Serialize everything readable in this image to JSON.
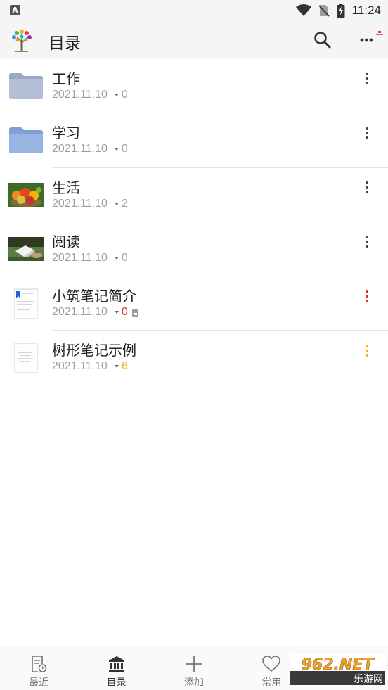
{
  "status_bar": {
    "left_icon_letter": "A",
    "time": "11:24",
    "icons": [
      "wifi-icon",
      "no-sim-icon",
      "battery-charging-icon"
    ]
  },
  "app_bar": {
    "title": "目录",
    "logo": "tree-logo-icon",
    "actions": [
      "search-icon",
      "more-icon",
      "upload-badge-icon"
    ]
  },
  "items": [
    {
      "title": "工作",
      "date": "2021.11.10",
      "count": "0",
      "count_color": "#9e9e9e",
      "kebab_color": "#424242",
      "thumb": "folder-icon",
      "doc_badge": false
    },
    {
      "title": "学习",
      "date": "2021.11.10",
      "count": "0",
      "count_color": "#9e9e9e",
      "kebab_color": "#424242",
      "thumb": "folder-icon",
      "doc_badge": false
    },
    {
      "title": "生活",
      "date": "2021.11.10",
      "count": "2",
      "count_color": "#9e9e9e",
      "kebab_color": "#424242",
      "thumb": "fruit-photo",
      "doc_badge": false
    },
    {
      "title": "阅读",
      "date": "2021.11.10",
      "count": "0",
      "count_color": "#9e9e9e",
      "kebab_color": "#424242",
      "thumb": "reading-photo",
      "doc_badge": false
    },
    {
      "title": "小筑笔记简介",
      "date": "2021.11.10",
      "count": "0",
      "count_color": "#d32f2f",
      "kebab_color": "#d32f2f",
      "thumb": "note-page-icon",
      "doc_badge": true
    },
    {
      "title": "树形笔记示例",
      "date": "2021.11.10",
      "count": "6",
      "count_color": "#f5b400",
      "kebab_color": "#f5b400",
      "thumb": "note-page-icon",
      "doc_badge": false
    }
  ],
  "bottom_nav": [
    {
      "label": "最近",
      "icon": "recent-icon",
      "active": false
    },
    {
      "label": "目录",
      "icon": "catalog-icon",
      "active": true
    },
    {
      "label": "添加",
      "icon": "add-icon",
      "active": false
    },
    {
      "label": "常用",
      "icon": "heart-icon",
      "active": false
    },
    {
      "label": "",
      "icon": "settings-icon",
      "active": false
    }
  ],
  "watermark": {
    "top": "962.NET",
    "bottom": "乐游网"
  }
}
